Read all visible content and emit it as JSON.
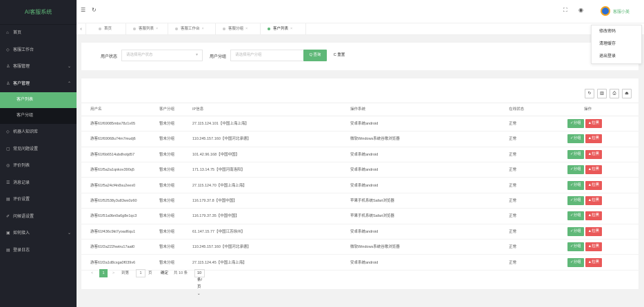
{
  "app": {
    "title": "AI客服系统"
  },
  "sidebar": {
    "items": [
      {
        "icon": "home-icon",
        "glyph": "⌂",
        "label": "首页"
      },
      {
        "icon": "workbench-icon",
        "glyph": "◇",
        "label": "客服工作台"
      },
      {
        "icon": "user-icon",
        "glyph": "♙",
        "label": "客服管理",
        "arrow": "⌄"
      },
      {
        "icon": "customer-icon",
        "glyph": "♙",
        "label": "客户管理",
        "arrow": "⌃"
      },
      {
        "icon": "robot-icon",
        "glyph": "◇",
        "label": "机器人知识库"
      },
      {
        "icon": "faq-icon",
        "glyph": "▢",
        "label": "常见问题设置"
      },
      {
        "icon": "review-icon",
        "glyph": "◎",
        "label": "评价列表"
      },
      {
        "icon": "message-icon",
        "glyph": "☰",
        "label": "消息记录"
      },
      {
        "icon": "review-settings-icon",
        "glyph": "▤",
        "label": "评价设置"
      },
      {
        "icon": "greeting-icon",
        "glyph": "✐",
        "label": "问候语设置"
      },
      {
        "icon": "integration-icon",
        "glyph": "▣",
        "label": "如何接入",
        "arrow": "⌄"
      },
      {
        "icon": "login-log-icon",
        "glyph": "▤",
        "label": "登录日志"
      }
    ],
    "submenu": [
      "客户列表",
      "客户分组"
    ]
  },
  "header": {
    "user_name": "客服小美",
    "dropdown": [
      "修改密码",
      "清理缓存",
      "退出登录"
    ]
  },
  "tabs": [
    {
      "label": "首页"
    },
    {
      "label": "客服列表"
    },
    {
      "label": "客服工作台"
    },
    {
      "label": "客服分组"
    },
    {
      "label": "客户列表"
    }
  ],
  "filter": {
    "status_label": "用户状态",
    "status_placeholder": "请选择用户状态",
    "group_label": "用户分组",
    "group_placeholder": "请选择用户分组",
    "search_btn": "Q 查询",
    "reset_btn": "C 重置"
  },
  "table": {
    "headers": [
      "用户名",
      "客户分组",
      "IP信息",
      "操作系统",
      "在线状态",
      "操作"
    ],
    "rows": [
      {
        "name": "游客61f69085mbs78z1v05",
        "group": "暂未分组",
        "ip": "27.115.124.101【中国上海上海】",
        "os": "安卓系统android",
        "status": "正常"
      },
      {
        "name": "游客61f69068u74m7mudj6",
        "group": "暂未分组",
        "ip": "110.245.157.160【中国河北承德】",
        "os": "微软Windows系统谷歌浏览器",
        "status": "正常"
      },
      {
        "name": "游客61f6b6514ubdhotjd57",
        "group": "暂未分组",
        "ip": "101.42.96.168【中国中国】",
        "os": "安卓系统android",
        "status": "正常"
      },
      {
        "name": "游客61f5a2a1qnkov390q5",
        "group": "暂未分组",
        "ip": "171.13.14.75【中国河南洛阳】",
        "os": "安卓系统android",
        "status": "正常"
      },
      {
        "name": "游客61f5a24cf4n8su2eex0",
        "group": "暂未分组",
        "ip": "27.115.124.70【中国上海上海】",
        "os": "安卓系统android",
        "status": "正常"
      },
      {
        "name": "游客61f52538y3u83ws0z60",
        "group": "暂未分组",
        "ip": "116.179.37.8【中国中国】",
        "os": "苹果手机系统Safari浏览器",
        "status": "正常"
      },
      {
        "name": "游客61f51a9bn0a6g8e1qc3",
        "group": "暂未分组",
        "ip": "116.179.37.35【中国中国】",
        "os": "苹果手机系统Safari浏览器",
        "status": "正常"
      },
      {
        "name": "游客61f436c9kt7yoad6qu1",
        "group": "暂未分组",
        "ip": "61.147.15.77【中国江苏徐州】",
        "os": "安卓系统android",
        "status": "正常"
      },
      {
        "name": "游客61f2a222hwtru17aat0",
        "group": "暂未分组",
        "ip": "110.245.157.160【中国河北承德】",
        "os": "微软Windows系统谷歌浏览器",
        "status": "正常"
      },
      {
        "name": "游客61f2a1d8cxga0f039v6",
        "group": "暂未分组",
        "ip": "27.115.124.45【中国上海上海】",
        "os": "安卓系统android",
        "status": "正常"
      }
    ],
    "group_btn": "✓分组",
    "blacklist_btn": "▲拉黑"
  },
  "pager": {
    "prev": "<",
    "current": "1",
    "next": ">",
    "goto": "到第",
    "page_input": "1",
    "page_unit": "页",
    "confirm": "确定",
    "total": "共 10 条",
    "page_size": "10 条/页 ⌄"
  },
  "colors": {
    "accent": "#5fb878",
    "danger": "#e95858",
    "sidebar_bg": "#20222a"
  }
}
